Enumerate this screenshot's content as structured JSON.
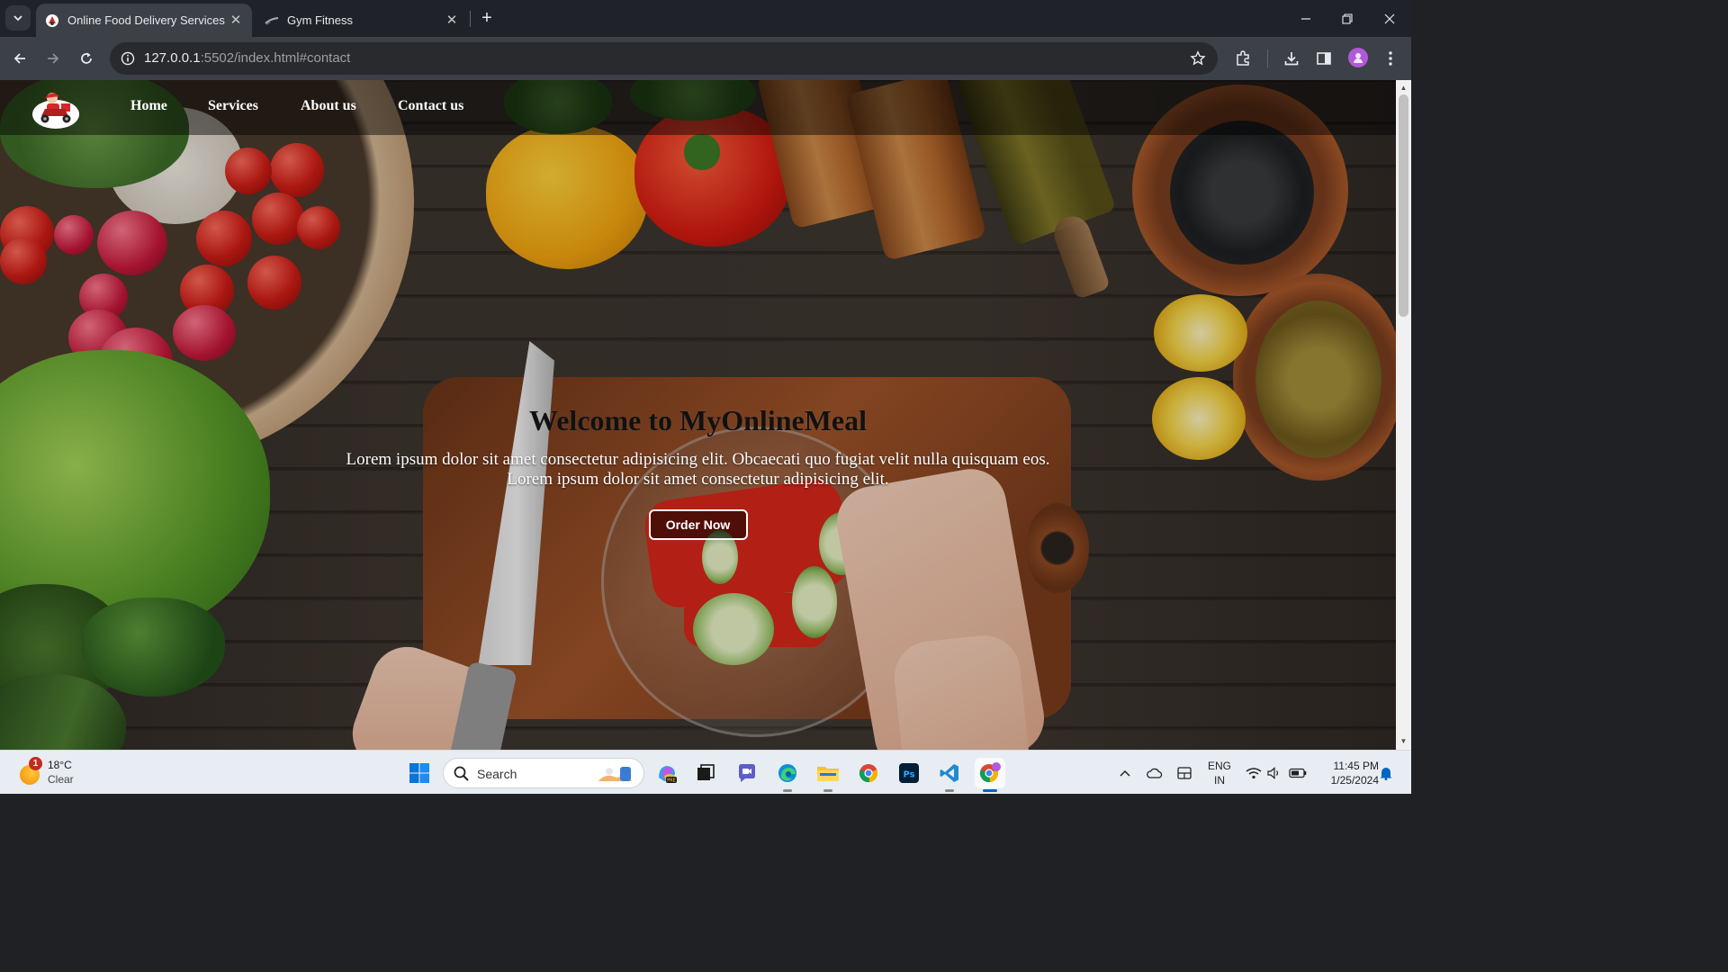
{
  "browser": {
    "tabs": [
      {
        "title": "Online Food Delivery Services",
        "active": true
      },
      {
        "title": "Gym Fitness",
        "active": false
      }
    ],
    "close_glyph": "✕",
    "new_tab_glyph": "+",
    "url_host": "127.0.0.1",
    "url_path": ":5502/index.html#contact"
  },
  "site": {
    "nav": [
      "Home",
      "Services",
      "About us",
      "Contact us"
    ],
    "hero_title": "Welcome to MyOnlineMeal",
    "hero_line1": "Lorem ipsum dolor sit amet consectetur adipisicing elit. Obcaecati quo fugiat velit nulla quisquam eos.",
    "hero_line2": "Lorem ipsum dolor sit amet consectetur adipisicing elit.",
    "order_button": "Order Now"
  },
  "taskbar": {
    "weather_badge": "1",
    "weather_temp": "18°C",
    "weather_cond": "Clear",
    "search_placeholder": "Search",
    "lang_line1": "ENG",
    "lang_line2": "IN",
    "time": "11:45 PM",
    "date": "1/25/2024",
    "apps": [
      "start-icon",
      "copilot-icon",
      "task-view-icon",
      "teams-icon",
      "edge-icon",
      "file-explorer-icon",
      "chrome-icon",
      "photoshop-icon",
      "vscode-icon",
      "chrome-profile-icon"
    ]
  },
  "colors": {
    "tab_active": "#3c4047",
    "tab_bar": "#1f2329",
    "accent_blue": "#0067c0",
    "profile_purple": "#b05ad8"
  }
}
